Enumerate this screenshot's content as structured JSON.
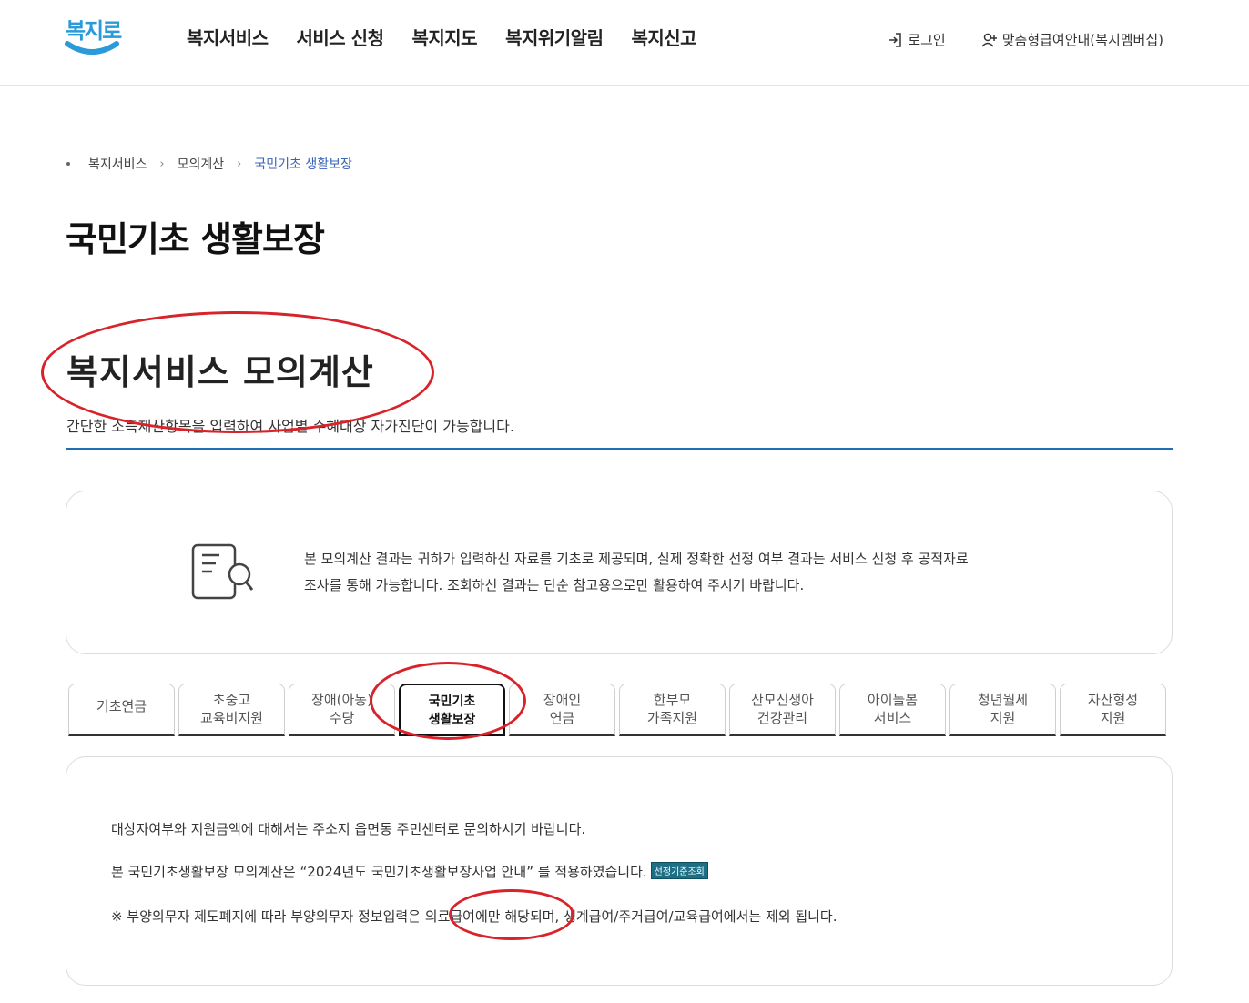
{
  "header": {
    "logo": "복지로",
    "nav": [
      "복지서비스",
      "서비스 신청",
      "복지지도",
      "복지위기알림",
      "복지신고"
    ],
    "login": "로그인",
    "membership": "맞춤형급여안내(복지멤버십)"
  },
  "breadcrumb": {
    "items": [
      "복지서비스",
      "모의계산"
    ],
    "current": "국민기초 생활보장"
  },
  "page_title": "국민기초 생활보장",
  "section": {
    "title": "복지서비스 모의계산",
    "description": "간단한 소득재산항목을 입력하여 사업별 수혜대상 자가진단이 가능합니다."
  },
  "notice": {
    "line1": "본 모의계산 결과는 귀하가 입력하신 자료를 기초로 제공되며, 실제 정확한 선정 여부 결과는 서비스 신청 후 공적자료",
    "line2": "조사를 통해 가능합니다. 조회하신 결과는 단순 참고용으로만 활용하여 주시기 바랍니다."
  },
  "tabs": [
    {
      "line1": "기초연금",
      "line2": ""
    },
    {
      "line1": "초중고",
      "line2": "교육비지원"
    },
    {
      "line1": "장애(아동)",
      "line2": "수당"
    },
    {
      "line1": "국민기초",
      "line2": "생활보장"
    },
    {
      "line1": "장애인",
      "line2": "연금"
    },
    {
      "line1": "한부모",
      "line2": "가족지원"
    },
    {
      "line1": "산모신생아",
      "line2": "건강관리"
    },
    {
      "line1": "아이돌봄",
      "line2": "서비스"
    },
    {
      "line1": "청년월세",
      "line2": "지원"
    },
    {
      "line1": "자산형성",
      "line2": "지원"
    }
  ],
  "active_tab_index": 3,
  "content": {
    "line1": "대상자여부와 지원금액에 대해서는 주소지 읍면동 주민센터로 문의하시기 바랍니다.",
    "line2": "본 국민기초생활보장 모의계산은 “2024년도 국민기초생활보장사업 안내” 를 적용하였습니다.",
    "badge": "선정기준조회",
    "line3": "※ 부양의무자 제도폐지에 따라 부양의무자 정보입력은 의료급여에만 해당되며, 생계급여/주거급여/교육급여에서는 제외 됩니다."
  },
  "colors": {
    "accent": "#1f6fb5",
    "annotation": "#d8232a",
    "breadcrumb_current": "#3a63b8",
    "badge": "#1d6f86"
  },
  "icons": [
    "logo-smile-icon",
    "login-icon",
    "user-plus-icon",
    "chevron-right-icon",
    "document-search-icon"
  ]
}
